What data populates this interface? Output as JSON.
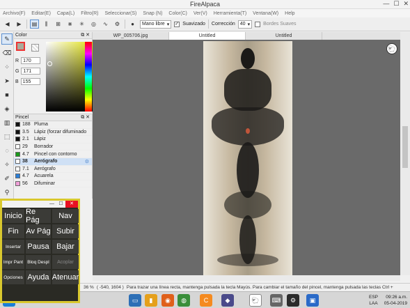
{
  "window": {
    "title": "FireAlpaca",
    "controls": [
      "—",
      "☐",
      "✕"
    ]
  },
  "menu": [
    "Archivo(F)",
    "Editar(E)",
    "Capa(L)",
    "Filtro(R)",
    "Seleccionar(S)",
    "Snap (N)",
    "Color(C)",
    "Ver(V)",
    "Herramienta(T)",
    "Ventana(W)",
    "Help"
  ],
  "toolbar": {
    "brush_mode": "Mano libre",
    "smoothing_label": "Suavizado",
    "smoothing_checked": true,
    "correction_label": "Corrección",
    "correction_value": "40",
    "soft_edges_label": "Bordes Suaves",
    "soft_edges_checked": false
  },
  "color_panel": {
    "title": "Color",
    "fg_color": "#aaab9b",
    "r": "170",
    "g": "171",
    "b": "155"
  },
  "brush_panel": {
    "title": "Pincel",
    "items": [
      {
        "size": "188",
        "name": "Pluma",
        "color": "#111111"
      },
      {
        "size": "3.5",
        "name": "Lápiz (forzar difuminado",
        "color": "#111111"
      },
      {
        "size": "2.1",
        "name": "Lápiz",
        "color": "#111111"
      },
      {
        "size": "29",
        "name": "Borrador",
        "color": "#ffffff"
      },
      {
        "size": "4.7",
        "name": "Pincel con contorno",
        "color": "#1a9a1a"
      },
      {
        "size": "38",
        "name": "Aerógrafo",
        "color": "#ffffff",
        "selected": true
      },
      {
        "size": "7.1",
        "name": "Aerógrafo",
        "color": "#ffffff"
      },
      {
        "size": "4.7",
        "name": "Acuarela",
        "color": "#2b7fd8"
      },
      {
        "size": "56",
        "name": "Difuminar",
        "color": "#f0a0d8"
      }
    ]
  },
  "doc_tabs": [
    "WP_005706.jpg",
    "Untitled",
    "Untitled"
  ],
  "active_tab": 1,
  "status": {
    "zoom": "36 %",
    "coords": "( -540, 1604 )",
    "hint": "Para trazar una línea recta, mantenga pulsada la tecla Mayús. Para cambiar el tamaño del pincel, mantenga pulsada las teclas Ctrl +"
  },
  "osk": {
    "keys": [
      [
        "Inicio",
        "Re Pág",
        "Nav"
      ],
      [
        "Fin",
        "Av Pág",
        "Subir"
      ],
      [
        "Insertar",
        "Pausa",
        "Bajar"
      ],
      [
        "Impr Pant",
        "Bloq Despl",
        "Acoplar"
      ],
      [
        "Opciones",
        "Ayuda",
        "Atenuar"
      ]
    ]
  },
  "taskbar": {
    "lang": "ESP",
    "lang2": "LAA",
    "time": "09:26 a.m.",
    "date": "05-04-2019"
  }
}
